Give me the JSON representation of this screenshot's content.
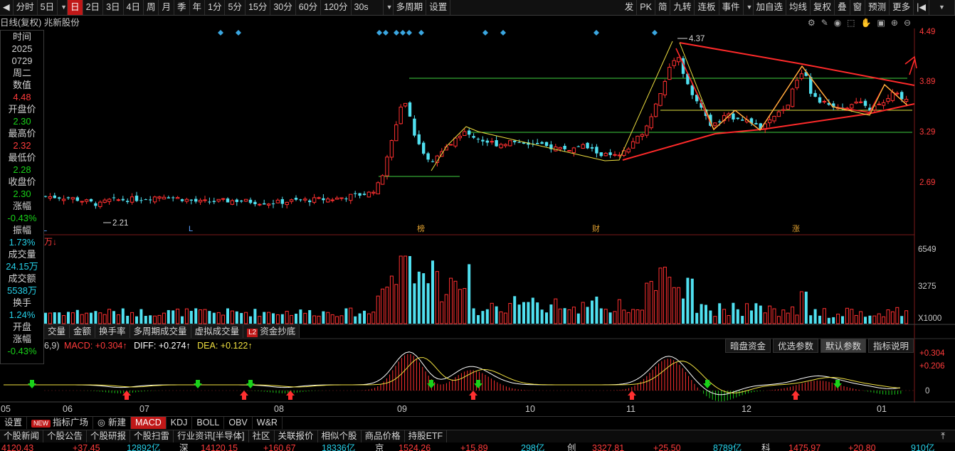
{
  "toolbar": {
    "left_items": [
      "分时",
      "5日",
      "日",
      "2日",
      "3日",
      "4日",
      "周",
      "月",
      "季",
      "年",
      "1分",
      "5分",
      "15分",
      "30分",
      "60分",
      "120分",
      "30s",
      "多周期",
      "设置"
    ],
    "active_item": "日",
    "right_items": [
      "发",
      "PK",
      "简",
      "九转",
      "连板",
      "事件",
      "加自选",
      "均线",
      "复权",
      "叠",
      "窗",
      "预测",
      "更多"
    ]
  },
  "chart": {
    "title": "日线(复权) 兆新股份",
    "price_labels": [
      "4.49",
      "3.89",
      "3.29",
      "2.69"
    ],
    "high_marker": "4.37",
    "low_marker": "2.21",
    "event_marks": [
      "L",
      "L",
      "榜",
      "财",
      "涨"
    ],
    "volume_unit": "万↓",
    "volume_labels": [
      "6549",
      "3275",
      "X1000"
    ],
    "macd_labels": [
      "+0.304",
      "+0.206",
      "0"
    ]
  },
  "info_panel": [
    {
      "label": "时间",
      "value": "2025",
      "value_class": "lbl"
    },
    {
      "label": "",
      "value": "0729",
      "value_class": "lbl"
    },
    {
      "label": "周二",
      "value": "",
      "value_class": "lbl"
    },
    {
      "label": "数值",
      "value": "4.48",
      "value_class": "c-red"
    },
    {
      "label": "开盘价",
      "value": "2.30",
      "value_class": "c-green"
    },
    {
      "label": "最高价",
      "value": "2.32",
      "value_class": "c-red"
    },
    {
      "label": "最低价",
      "value": "2.28",
      "value_class": "c-green"
    },
    {
      "label": "收盘价",
      "value": "2.30",
      "value_class": "c-green"
    },
    {
      "label": "涨幅",
      "value": "-0.43%",
      "value_class": "c-green"
    },
    {
      "label": "振幅",
      "value": "1.73%",
      "value_class": "c-cyan"
    },
    {
      "label": "成交量",
      "value": "24.15万",
      "value_class": "c-cyan"
    },
    {
      "label": "成交额",
      "value": "5538万",
      "value_class": "c-cyan"
    },
    {
      "label": "换手",
      "value": "1.24%",
      "value_class": "c-cyan"
    },
    {
      "label": "开盘",
      "value": "",
      "value_class": "lbl"
    },
    {
      "label": "涨幅",
      "value": "-0.43%",
      "value_class": "c-green"
    }
  ],
  "volume_tabs": [
    "交量",
    "金额",
    "换手率",
    "多周期成交量",
    "虚拟成交量",
    "资金抄底"
  ],
  "volume_tab_badge": "L2",
  "macd": {
    "params": "6,9)",
    "macd_text": "MACD: +0.304↑",
    "diff_text": "DIFF: +0.274↑",
    "dea_text": "DEA: +0.122↑",
    "buttons": [
      "暗盘资金",
      "优选参数",
      "默认参数",
      "指标说明"
    ],
    "selected_button": "默认参数"
  },
  "months": [
    "05",
    "06",
    "07",
    "08",
    "09",
    "10",
    "11",
    "12",
    "01"
  ],
  "indicator_tabs": [
    "设置",
    "指标广场",
    "新建",
    "MACD",
    "KDJ",
    "BOLL",
    "OBV",
    "W&R"
  ],
  "indicator_badge": "NEW",
  "selected_indicator": "MACD",
  "news_tabs": [
    "个股新闻",
    "个股公告",
    "个股研报",
    "个股扫雷",
    "行业资讯[半导体]",
    "社区",
    "关联报价",
    "相似个股",
    "商品价格",
    "持股ETF"
  ],
  "ticker": [
    "4120.43",
    "+37.45",
    "12892亿",
    "深",
    "14120.15",
    "+160.67",
    "18336亿",
    "京",
    "1524.26",
    "+15.89",
    "298亿",
    "创",
    "3327.81",
    "+25.50",
    "8789亿",
    "科",
    "1475.97",
    "+20.80",
    "910亿"
  ],
  "chart_data": {
    "type": "candlestick",
    "title": "日线(复权) 兆新股份",
    "ylim": [
      2.21,
      4.37
    ],
    "y_ticks": [
      2.69,
      3.29,
      3.89,
      4.49
    ],
    "x_months": [
      "05",
      "06",
      "07",
      "08",
      "09",
      "10",
      "11",
      "12",
      "01"
    ],
    "high": 4.37,
    "low": 2.21,
    "volume_max": 6549,
    "macd_max": 0.304
  }
}
